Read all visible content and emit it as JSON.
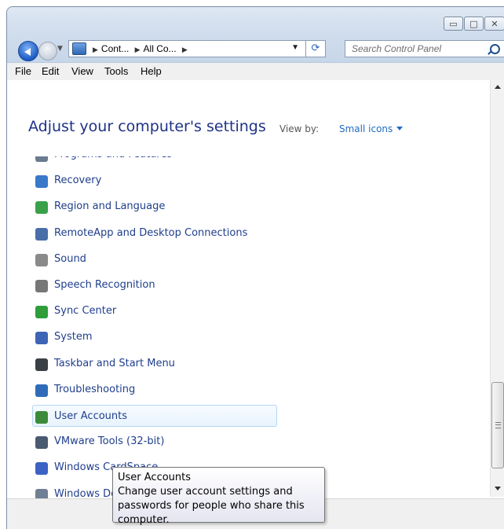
{
  "window": {
    "caption_buttons": {
      "minimize": "▭",
      "maximize": "□",
      "close": "✕"
    }
  },
  "navigation": {
    "address_crumbs": [
      "Cont...",
      "All Co..."
    ],
    "search_placeholder": "Search Control Panel"
  },
  "menubar": {
    "items": [
      "File",
      "Edit",
      "View",
      "Tools",
      "Help"
    ]
  },
  "main": {
    "heading": "Adjust your computer's settings",
    "view_by_label": "View by:",
    "view_by_value": "Small icons"
  },
  "items": [
    {
      "label": "Programs and Features",
      "icon": "programs-features-icon",
      "color": "#6b7b90"
    },
    {
      "label": "Recovery",
      "icon": "recovery-icon",
      "color": "#3a78c9"
    },
    {
      "label": "Region and Language",
      "icon": "globe-icon",
      "color": "#3aa04a"
    },
    {
      "label": "RemoteApp and Desktop Connections",
      "icon": "remoteapp-icon",
      "color": "#4a6fa8"
    },
    {
      "label": "Sound",
      "icon": "speaker-icon",
      "color": "#8a8a8a"
    },
    {
      "label": "Speech Recognition",
      "icon": "microphone-icon",
      "color": "#777777"
    },
    {
      "label": "Sync Center",
      "icon": "sync-icon",
      "color": "#2e9d3a"
    },
    {
      "label": "System",
      "icon": "system-icon",
      "color": "#3d64b5"
    },
    {
      "label": "Taskbar and Start Menu",
      "icon": "taskbar-icon",
      "color": "#3b3f46"
    },
    {
      "label": "Troubleshooting",
      "icon": "troubleshooting-icon",
      "color": "#2f6bb8"
    },
    {
      "label": "User Accounts",
      "icon": "users-icon",
      "color": "#3b8b3a",
      "selected": true
    },
    {
      "label": "VMware Tools (32-bit)",
      "icon": "vmware-icon",
      "color": "#4a5a70"
    },
    {
      "label": "Windows CardSpace",
      "icon": "windows-cardspace-icon",
      "color": "#3b62c4"
    },
    {
      "label": "Windows Defender",
      "icon": "windows-icon",
      "color": "#6f7f95"
    }
  ],
  "tooltip": {
    "title": "User Accounts",
    "line1": "Change user account settings and",
    "line2": "passwords for people who share this",
    "line3": "computer."
  }
}
